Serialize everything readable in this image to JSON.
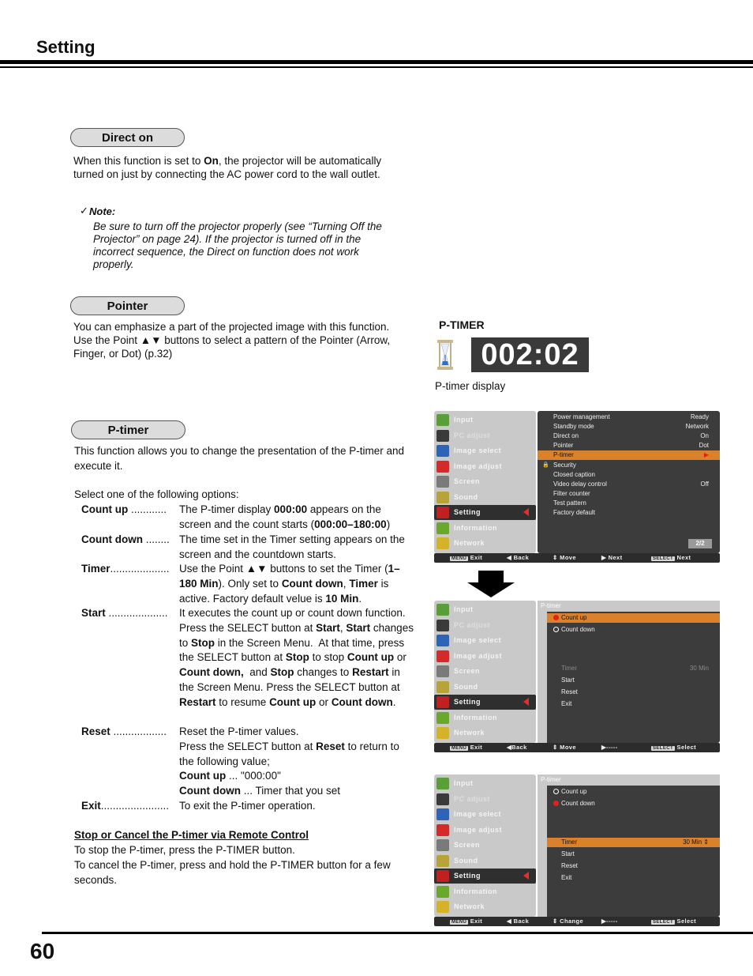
{
  "header": {
    "title": "Setting"
  },
  "page_number": "60",
  "direct_on": {
    "heading": "Direct on",
    "text_pre": "When this function is set to ",
    "text_bold": "On",
    "text_post": ", the projector will be automatically turned on just by connecting the AC power cord to the wall outlet.",
    "note_icon": "checkmark-icon",
    "note_label": "Note:",
    "note_text": "Be sure to turn off the projector properly (see “Turning Off the Projector” on page 24). If the projector is turned off in the incorrect sequence, the Direct on function does not work properly."
  },
  "pointer": {
    "heading": "Pointer",
    "text": "You can emphasize a part of the projected image with this function. Use the Point ▲▼ buttons to select a pattern of the Pointer (Arrow, Finger, or Dot) (p.32)"
  },
  "ptimer": {
    "heading": "P-timer",
    "intro": "This function allows you to change the presentation of the P-timer and execute it.",
    "select_line": "Select one of the following options:",
    "options": [
      {
        "term": "Count up",
        "dots": " ............",
        "desc_html": "The P-timer display <b>000:00</b> appears on the screen and the count starts (<b>000:00–180:00</b>)"
      },
      {
        "term": "Count down",
        "dots": " ........",
        "desc_html": "The time set in the Timer setting appears on the screen and the countdown starts."
      },
      {
        "term": "Timer",
        "dots": "....................",
        "desc_html": "Use the Point ▲▼ buttons to set the Timer (<b>1–180 Min</b>). Only set to <b>Count down</b>, <b>Timer</b> is active. Factory default velue is <b>10 Min</b>."
      },
      {
        "term": "Start",
        "dots": " ....................",
        "desc_html": "It executes the count up or count down function. Press the SELECT button at <b>Start</b>, <b>Start</b> changes to <b>Stop</b> in the Screen Menu.&nbsp; At that time, press the SELECT button at <b>Stop</b> to stop <b>Count up</b> or <b>Count down,</b>&nbsp; and <b>Stop</b> changes to <b>Restart</b> in the Screen Menu. Press the SELECT button at <b>Restart</b> to resume <b>Count up</b> or <b>Count down</b>."
      },
      {
        "term": "Reset",
        "dots": " ..................",
        "desc_html": "Reset the P-timer values.<br>Press the SELECT button at <b>Reset</b> to return to the following value;<br><b>Count up</b> ... \"000:00\"<br><b>Count down</b> ... Timer that you set"
      },
      {
        "term": "Exit",
        "dots": ".......................",
        "desc_html": "To exit the P-timer operation."
      }
    ],
    "remote_heading": "Stop or Cancel the P-timer via Remote Control",
    "remote_line1": "To stop the P-timer, press the P-TIMER button.",
    "remote_line2": "To cancel the P-timer, press and hold the P-TIMER button for a few seconds."
  },
  "ptimer_display": {
    "label": "P-TIMER",
    "time": "002:02",
    "caption": "P-timer display",
    "icon": "hourglass-icon"
  },
  "osd_left_menu": [
    {
      "label": "Input",
      "icon": "input-icon",
      "color": "#5a9e3a"
    },
    {
      "label": "PC adjust",
      "icon": "pc-adjust-icon",
      "color": "#3a3a3a",
      "dim": true
    },
    {
      "label": "Image select",
      "icon": "image-select-icon",
      "color": "#2d63b8"
    },
    {
      "label": "Image adjust",
      "icon": "image-adjust-icon",
      "color": "#d42a2a"
    },
    {
      "label": "Screen",
      "icon": "screen-icon",
      "color": "#7a7a7a"
    },
    {
      "label": "Sound",
      "icon": "sound-icon",
      "color": "#b8a23a"
    },
    {
      "label": "Setting",
      "icon": "setting-icon",
      "color": "#c02020",
      "selected": true
    },
    {
      "label": "Information",
      "icon": "information-icon",
      "color": "#6aa82a"
    },
    {
      "label": "Network",
      "icon": "network-icon",
      "color": "#d4b22a"
    }
  ],
  "osd1": {
    "rows": [
      {
        "k": "Power management",
        "v": "Ready"
      },
      {
        "k": "Standby mode",
        "v": "Network"
      },
      {
        "k": "Direct on",
        "v": "On"
      },
      {
        "k": "Pointer",
        "v": "Dot"
      },
      {
        "k": "P-timer",
        "v": "▶",
        "hi": true
      },
      {
        "k": "Security",
        "v": "",
        "lock": true
      },
      {
        "k": "Closed caption",
        "v": ""
      },
      {
        "k": "Video delay control",
        "v": "Off"
      },
      {
        "k": "Filter counter",
        "v": ""
      },
      {
        "k": "Test pattern",
        "v": ""
      },
      {
        "k": "Factory default",
        "v": ""
      }
    ],
    "page": "2/2",
    "footer": [
      {
        "key": "MENU",
        "label": "Exit"
      },
      {
        "key": "",
        "label": "◀ Back"
      },
      {
        "key": "",
        "label": "⇕ Move"
      },
      {
        "key": "",
        "label": "▶ Next"
      },
      {
        "key": "SELECT",
        "label": "Next"
      }
    ]
  },
  "osd2": {
    "header": "P-timer",
    "radio": [
      {
        "label": "Count up",
        "on": true,
        "hi": true
      },
      {
        "label": "Count down",
        "on": false
      }
    ],
    "rows": [
      {
        "k": "Timer",
        "v": "30 Min",
        "dim": true
      },
      {
        "k": "Start",
        "v": ""
      },
      {
        "k": "Reset",
        "v": ""
      },
      {
        "k": "Exit",
        "v": ""
      }
    ],
    "footer": [
      {
        "key": "MENU",
        "label": "Exit"
      },
      {
        "key": "",
        "label": "◀Back"
      },
      {
        "key": "",
        "label": "⇕ Move"
      },
      {
        "key": "",
        "label": "▶-----"
      },
      {
        "key": "SELECT",
        "label": "Select"
      }
    ]
  },
  "osd3": {
    "header": "P-timer",
    "radio": [
      {
        "label": "Count up",
        "on": false
      },
      {
        "label": "Count down",
        "on": true
      }
    ],
    "rows": [
      {
        "k": "Timer",
        "v": "30 Min ⇕",
        "hi": true
      },
      {
        "k": "Start",
        "v": ""
      },
      {
        "k": "Reset",
        "v": ""
      },
      {
        "k": "Exit",
        "v": ""
      }
    ],
    "footer": [
      {
        "key": "MENU",
        "label": "Exit"
      },
      {
        "key": "",
        "label": "◀ Back"
      },
      {
        "key": "",
        "label": "⇕ Change"
      },
      {
        "key": "",
        "label": "▶-----"
      },
      {
        "key": "SELECT",
        "label": "Select"
      }
    ]
  },
  "colors": {
    "highlight": "#d9822b",
    "osd_panel": "#3c3c3c",
    "osd_left": "#c9c9c9",
    "radio_on": "#e5201c"
  }
}
